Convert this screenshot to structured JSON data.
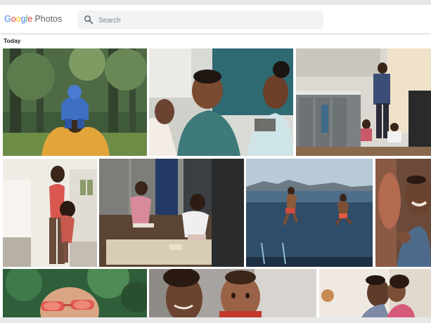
{
  "app": {
    "logo_letters": [
      "G",
      "o",
      "o",
      "g",
      "l",
      "e"
    ],
    "logo_colors": [
      "#4285f4",
      "#ea4335",
      "#fbbc05",
      "#4285f4",
      "#34a853",
      "#ea4335"
    ],
    "product_name": "Photos"
  },
  "search": {
    "placeholder": "Search",
    "value": "",
    "icon": "search-icon"
  },
  "section": {
    "label": "Today"
  },
  "photos": [
    {
      "id": "photo-child-on-shoulders-forest"
    },
    {
      "id": "photo-family-laughing-couch"
    },
    {
      "id": "photo-family-kitchen"
    },
    {
      "id": "photo-mother-daughter-playing"
    },
    {
      "id": "photo-kids-playing-floor"
    },
    {
      "id": "photo-jumping-into-lake"
    },
    {
      "id": "photo-father-laughing"
    },
    {
      "id": "photo-child-sunglasses"
    },
    {
      "id": "photo-mother-baby"
    },
    {
      "id": "photo-father-kiss-daughter"
    }
  ]
}
